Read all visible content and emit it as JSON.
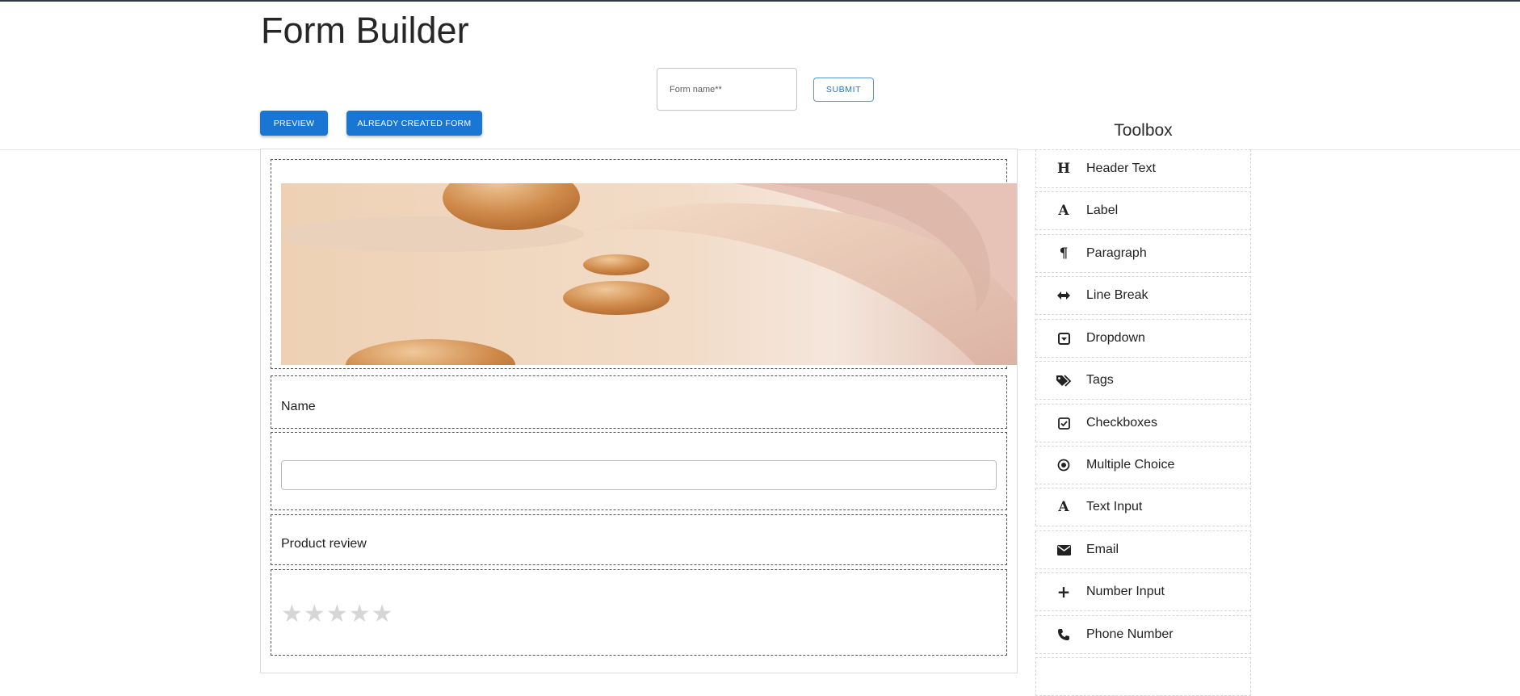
{
  "app": {
    "title": "Form Builder"
  },
  "form": {
    "name_placeholder": "Form name**",
    "name_value": ""
  },
  "buttons": {
    "submit": "SUBMIT",
    "preview": "PREVIEW",
    "already_created": "ALREADY CREATED FORM"
  },
  "canvas": {
    "name_label": "Name",
    "product_review_label": "Product review",
    "rating": {
      "value": 0,
      "max": 5
    }
  },
  "toolbox": {
    "title": "Toolbox",
    "items": [
      {
        "label": "Header Text",
        "icon": "header-icon"
      },
      {
        "label": "Label",
        "icon": "font-icon"
      },
      {
        "label": "Paragraph",
        "icon": "paragraph-icon"
      },
      {
        "label": "Line Break",
        "icon": "arrows-horizontal-icon"
      },
      {
        "label": "Dropdown",
        "icon": "dropdown-icon"
      },
      {
        "label": "Tags",
        "icon": "tags-icon"
      },
      {
        "label": "Checkboxes",
        "icon": "checkbox-icon"
      },
      {
        "label": "Multiple Choice",
        "icon": "radio-icon"
      },
      {
        "label": "Text Input",
        "icon": "font-icon"
      },
      {
        "label": "Email",
        "icon": "envelope-icon"
      },
      {
        "label": "Number Input",
        "icon": "plus-icon"
      },
      {
        "label": "Phone Number",
        "icon": "phone-icon"
      }
    ]
  },
  "colors": {
    "primary": "#1976d2",
    "top_bar": "#2f3a45"
  }
}
